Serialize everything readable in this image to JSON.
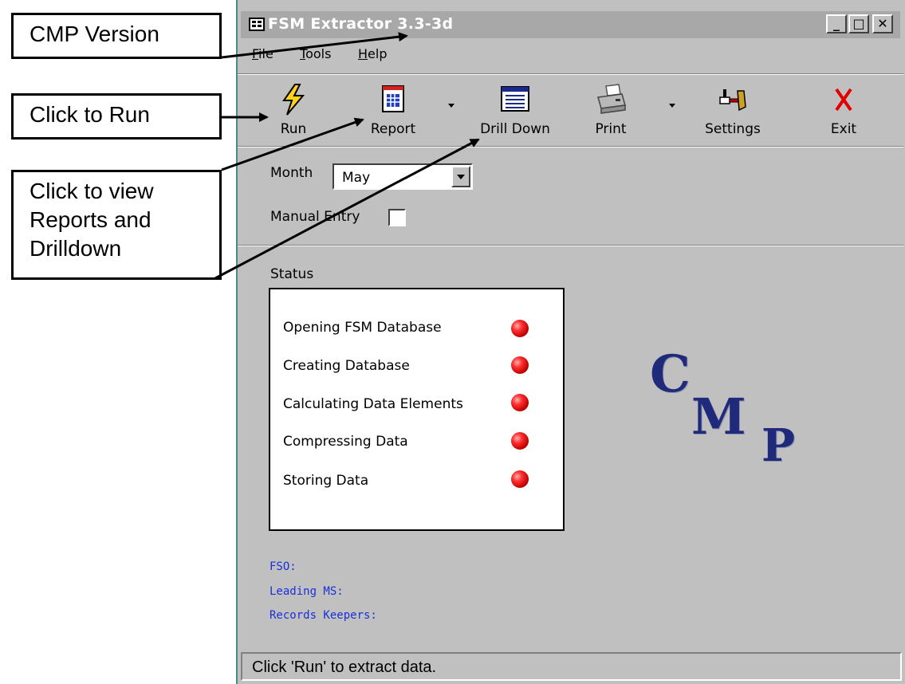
{
  "callouts": {
    "cmp_version": "CMP Version",
    "click_to_run": "Click to Run",
    "click_to_view_lines": [
      "Click to view",
      "Reports and",
      "Drilldown"
    ]
  },
  "window": {
    "title": "FSM Extractor 3.3-3d",
    "min_glyph": "_",
    "max_glyph": "□",
    "close_glyph": "✕"
  },
  "menu": {
    "file": {
      "hot": "F",
      "rest": "ile"
    },
    "tools": {
      "hot": "T",
      "rest": "ools"
    },
    "help": {
      "hot": "H",
      "rest": "elp"
    }
  },
  "toolbar": {
    "run": "Run",
    "report": "Report",
    "drill_down": "Drill Down",
    "print": "Print",
    "settings": "Settings",
    "exit": "Exit"
  },
  "form": {
    "month_label": "Month",
    "month_value": "May",
    "manual_entry_label": "Manual Entry",
    "manual_entry_checked": false
  },
  "status": {
    "heading": "Status",
    "steps": [
      "Opening FSM Database",
      "Creating Database",
      "Calculating Data Elements",
      "Compressing Data",
      "Storing Data"
    ]
  },
  "logo": {
    "c": "C",
    "m": "M",
    "p": "P",
    "color": "#1f2a7a"
  },
  "info": {
    "fso": "FSO:",
    "leading_ms": "Leading MS:",
    "records_keepers": "Records Keepers:"
  },
  "statusbar": {
    "text": "Click 'Run' to extract data."
  },
  "icons": {
    "run": "lightning-icon",
    "report": "calendar-icon",
    "drill_down": "table-icon",
    "print": "printer-icon",
    "settings": "tools-icon",
    "exit": "red-x-icon"
  }
}
